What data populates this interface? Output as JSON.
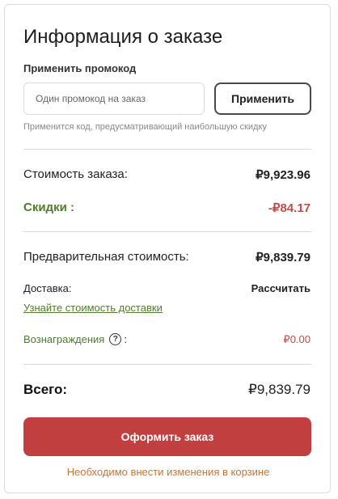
{
  "order": {
    "title": "Информация о заказе",
    "promo": {
      "label": "Применить промокод",
      "placeholder": "Один промокод на заказ",
      "value": "",
      "apply_label": "Применить",
      "hint": "Применится код, предусматривающий наибольшую скидку"
    },
    "subtotal": {
      "label": "Стоимость заказа:",
      "value": "₽9,923.96"
    },
    "discounts": {
      "label": "Скидки :",
      "value": "-₽84.17"
    },
    "preliminary": {
      "label": "Предварительная стоимость:",
      "value": "₽9,839.79"
    },
    "delivery": {
      "label": "Доставка:",
      "value": "Рассчитать",
      "link": "Узнайте стоимость доставки"
    },
    "rewards": {
      "label": "Вознаграждения",
      "suffix": ":",
      "value": "₽0.00",
      "help_icon": "question-circle-icon"
    },
    "total": {
      "label": "Всего:",
      "value": "₽9,839.79"
    },
    "checkout_label": "Оформить заказ",
    "notice": "Необходимо внести изменения в корзине"
  },
  "colors": {
    "accent_red": "#c23f3f",
    "green": "#4e7d2b",
    "notice_orange": "#c5763a"
  }
}
